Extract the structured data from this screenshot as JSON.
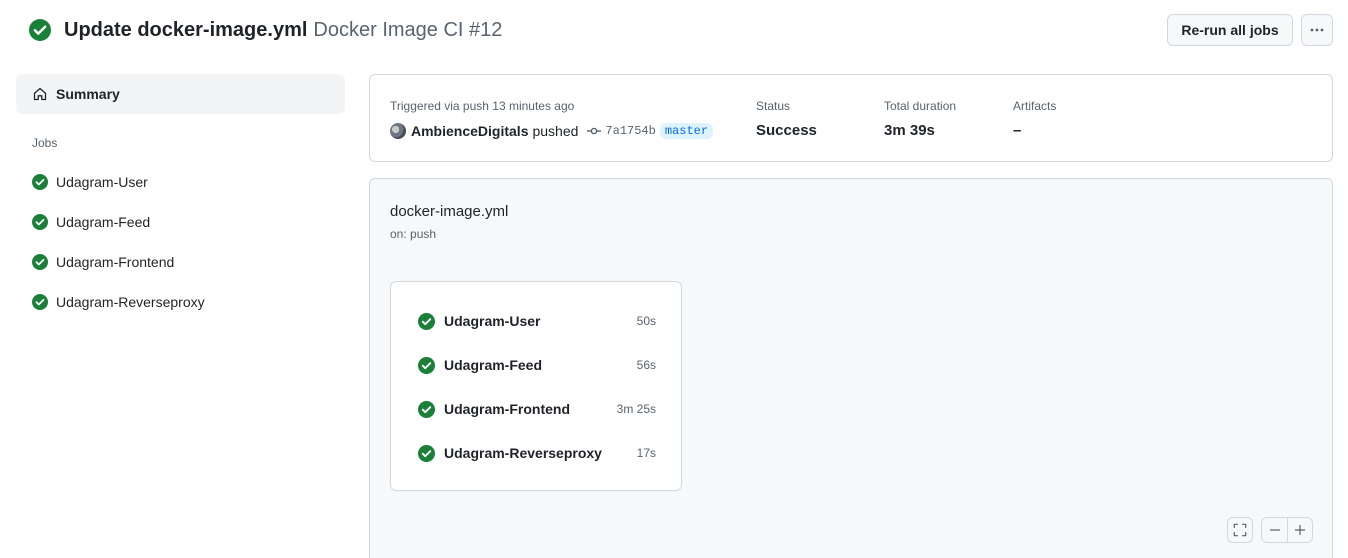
{
  "header": {
    "title": "Update docker-image.yml",
    "subtitle": "Docker Image CI #12",
    "rerun_label": "Re-run all jobs",
    "more_icon": "kebab-horizontal-icon"
  },
  "sidebar": {
    "summary_label": "Summary",
    "jobs_heading": "Jobs",
    "jobs": [
      {
        "label": "Udagram-User"
      },
      {
        "label": "Udagram-Feed"
      },
      {
        "label": "Udagram-Frontend"
      },
      {
        "label": "Udagram-Reverseproxy"
      }
    ]
  },
  "status_card": {
    "trigger_label": "Triggered via push 13 minutes ago",
    "actor": "AmbienceDigitals",
    "action": "pushed",
    "commit_sha": "7a1754b",
    "branch": "master",
    "status_label": "Status",
    "status_value": "Success",
    "duration_label": "Total duration",
    "duration_value": "3m 39s",
    "artifacts_label": "Artifacts",
    "artifacts_value": "–"
  },
  "workflow": {
    "name": "docker-image.yml",
    "trigger": "on: push",
    "jobs": [
      {
        "name": "Udagram-User",
        "duration": "50s"
      },
      {
        "name": "Udagram-Feed",
        "duration": "56s"
      },
      {
        "name": "Udagram-Frontend",
        "duration": "3m 25s"
      },
      {
        "name": "Udagram-Reverseproxy",
        "duration": "17s"
      }
    ]
  },
  "colors": {
    "success": "#1a7f37",
    "accent": "#0969da",
    "border": "#d1d9e0",
    "muted": "#59636e"
  }
}
